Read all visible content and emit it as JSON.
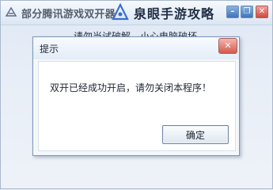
{
  "main_window": {
    "title": "部分腾讯游戏双开器",
    "behind_text": "请勿当试破解，小心电脑破坏",
    "buttons": {
      "minimize": "–",
      "restore": "❐",
      "close": "✕"
    }
  },
  "watermark": {
    "text": "泉眼手游攻略",
    "logo_icon": "triangle-logo-icon"
  },
  "dialog": {
    "title": "提示",
    "message": "双开已经成功开启，请勿关闭本程序！",
    "ok_label": "确定",
    "close_label": "✕"
  },
  "colors": {
    "title_bar": "#dbe6f3",
    "dialog_bg": "#f4f8fc",
    "close_red": "#d45a4c",
    "window_button_blue": "#3f74b9"
  }
}
